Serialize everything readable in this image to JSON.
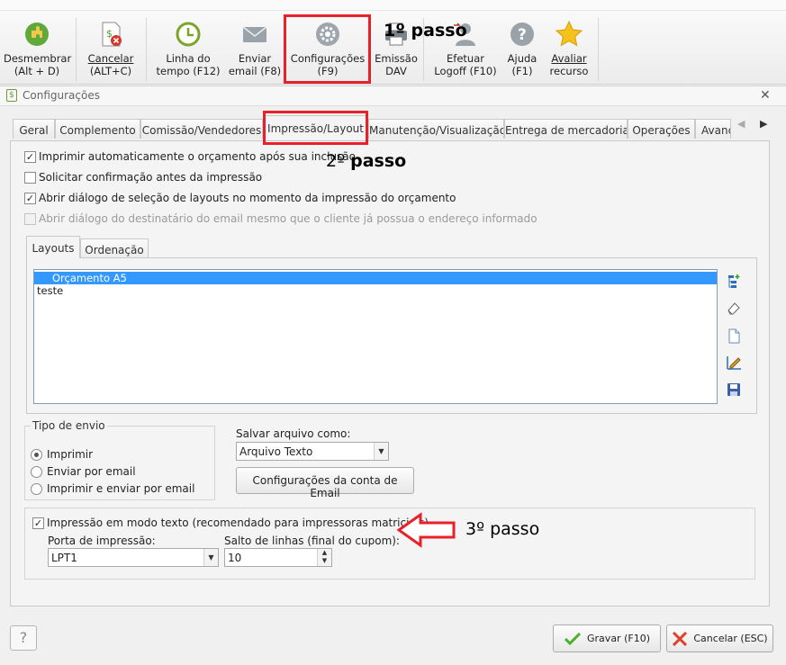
{
  "toolbar": {
    "buttons": [
      {
        "label1": "Desmembrar",
        "label2": "(Alt + D)"
      },
      {
        "label1": "Cancelar",
        "label2": "(ALT+C)"
      },
      {
        "label1": "Linha do",
        "label2": "tempo (F12)"
      },
      {
        "label1": "Enviar",
        "label2": "email (F8)"
      },
      {
        "label1": "Configurações",
        "label2": "(F9)"
      },
      {
        "label1": "Emissão",
        "label2": "DAV"
      },
      {
        "label1": "Efetuar",
        "label2": "Logoff (F10)"
      },
      {
        "label1": "Ajuda",
        "label2": "(F1)"
      },
      {
        "label1": "Avaliar",
        "label2": "recurso"
      }
    ],
    "icons": [
      "puzzle-icon",
      "cancel-dollar-icon",
      "clock-icon",
      "envelope-icon",
      "gear-icon",
      "printer-icon",
      "user-logoff-icon",
      "help-icon",
      "star-icon"
    ]
  },
  "annotations": {
    "step1": "1º passo",
    "step2_num": "2º",
    "step2_word": "passo",
    "step3": "3º passo",
    "highlight_color": "#e8202a"
  },
  "dialog": {
    "title": "Configurações",
    "close": "✕",
    "tabs": [
      "Geral",
      "Complemento",
      "Comissão/Vendedores",
      "Impressão/Layout",
      "Manutenção/Visualização",
      "Entrega de mercadoria",
      "Operações",
      "Avanç"
    ],
    "active_tab": "Impressão/Layout",
    "checkboxes": [
      {
        "label": "Imprimir automaticamente o orçamento após sua inclusão",
        "checked": true,
        "enabled": true
      },
      {
        "label": "Solicitar confirmação antes da impressão",
        "checked": false,
        "enabled": true
      },
      {
        "label": "Abrir diálogo de seleção de layouts no momento da impressão do orçamento",
        "checked": true,
        "enabled": true
      },
      {
        "label": "Abrir diálogo do destinatário do email mesmo que o cliente já possua o endereço informado",
        "checked": false,
        "enabled": false
      }
    ],
    "inner_tabs": [
      "Layouts",
      "Ordenação"
    ],
    "layouts": [
      "Orçamento A5",
      "teste"
    ],
    "selected_layout": "Orçamento A5",
    "side_icons": [
      "add-layout-icon",
      "eraser-icon",
      "new-document-icon",
      "edit-layout-icon",
      "save-icon"
    ],
    "tipo_envio": {
      "title": "Tipo de envio",
      "options": [
        "Imprimir",
        "Enviar por email",
        "Imprimir e enviar por email"
      ],
      "selected": "Imprimir"
    },
    "salvar": {
      "label": "Salvar arquivo como:",
      "value": "Arquivo Texto",
      "email_config_button": "Configurações da conta de Email"
    },
    "modo_texto": {
      "label": "Impressão em modo texto (recomendado para impressoras matriciais)",
      "checked": true,
      "porta_label": "Porta de impressão:",
      "porta_value": "LPT1",
      "salto_label": "Salto de linhas (final do cupom):",
      "salto_value": "10"
    },
    "footer": {
      "help": "?",
      "save_button": "Gravar (F10)",
      "cancel_button": "Cancelar (ESC)"
    }
  }
}
